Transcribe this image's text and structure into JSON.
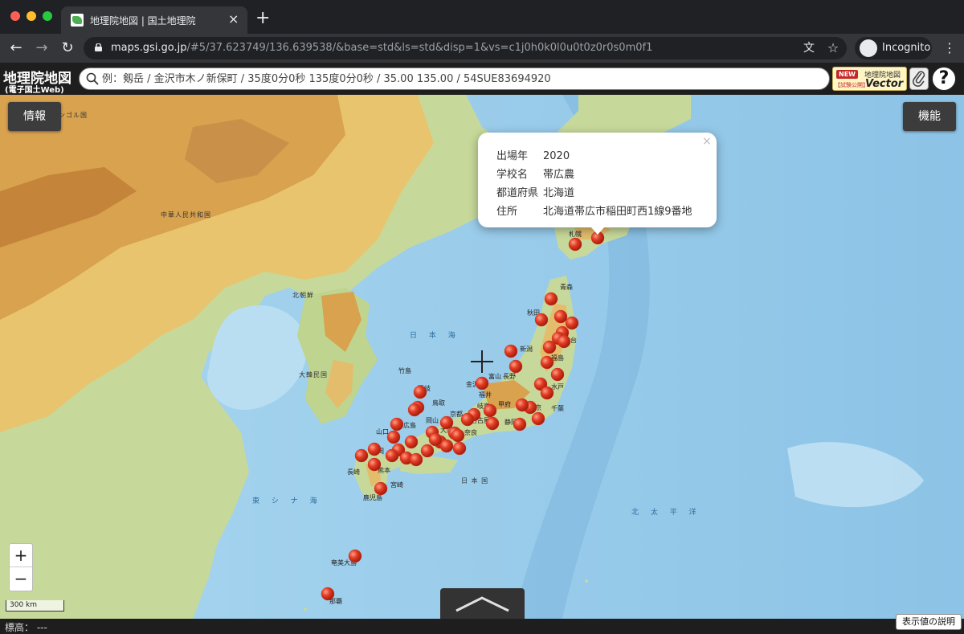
{
  "browser": {
    "tab_title": "地理院地図 | 国土地理院",
    "url_host": "maps.gsi.go.jp",
    "url_path": "/#5/37.623749/136.639538/&base=std&ls=std&disp=1&vs=c1j0h0k0l0u0t0z0r0s0m0f1",
    "incognito_label": "Incognito"
  },
  "site": {
    "logo_main": "地理院地図",
    "logo_sub": "(電子国土Web)",
    "search_placeholder": "例：剱岳 / 金沢市木ノ新保町 / 35度0分0秒 135度0分0秒 / 35.00 135.00 / 54SUE83694920",
    "vector_badge": {
      "new": "NEW",
      "trial": "【試験公開】",
      "title": "地理院地図",
      "vector": "Vector"
    },
    "help_label": "?"
  },
  "map": {
    "info_button": "情報",
    "function_button": "機能",
    "scale_label": "300 km",
    "zoom_in": "+",
    "zoom_out": "−",
    "sea_labels": {
      "sea_of_japan": "日 本 海",
      "east_china_sea": "東 シ ナ 海",
      "pacific": "北 太 平 洋",
      "japan": "日 本 国"
    },
    "country_labels": {
      "china": "中華人民共和国",
      "north_korea": "北朝鮮",
      "south_korea": "大韓民国",
      "mongolia": "モンゴル国"
    },
    "city_labels": {
      "sapporo": "札幌",
      "aomori": "青森",
      "akita": "秋田",
      "sendai": "仙台",
      "niigata": "新潟",
      "fukushima": "福島",
      "toyama": "富山",
      "kanazawa": "金沢",
      "nagano": "長野",
      "fukui": "福井",
      "kofu": "甲府",
      "mito": "水戸",
      "tokyo": "東京",
      "chiba": "千葉",
      "shizuoka": "静岡",
      "nagoya": "名古屋",
      "gifu": "岐阜",
      "kyoto": "京都",
      "osaka": "大阪",
      "nara": "奈良",
      "okayama": "岡山",
      "hiroshima": "広島",
      "matsue": "松江",
      "tottori": "鳥取",
      "yamaguchi": "山口",
      "fukuoka": "福岡",
      "nagasaki": "長崎",
      "kumamoto": "熊本",
      "miyazaki": "宮崎",
      "kagoshima": "鹿児島",
      "naha": "那覇",
      "takeshima": "竹島",
      "oki": "隠岐",
      "kyushu_amami": "奄美大島"
    },
    "marker_color": "#d32f1e",
    "popup": {
      "year_key": "出場年",
      "year_value": "2020",
      "school_key": "学校名",
      "school_value": "帯広農",
      "pref_key": "都道府県",
      "pref_value": "北海道",
      "addr_key": "住所",
      "addr_value": "北海道帯広市稲田町西1線9番地",
      "close": "×"
    }
  },
  "status": {
    "elevation": "標高：  ---",
    "legend_button": "表示値の説明"
  }
}
